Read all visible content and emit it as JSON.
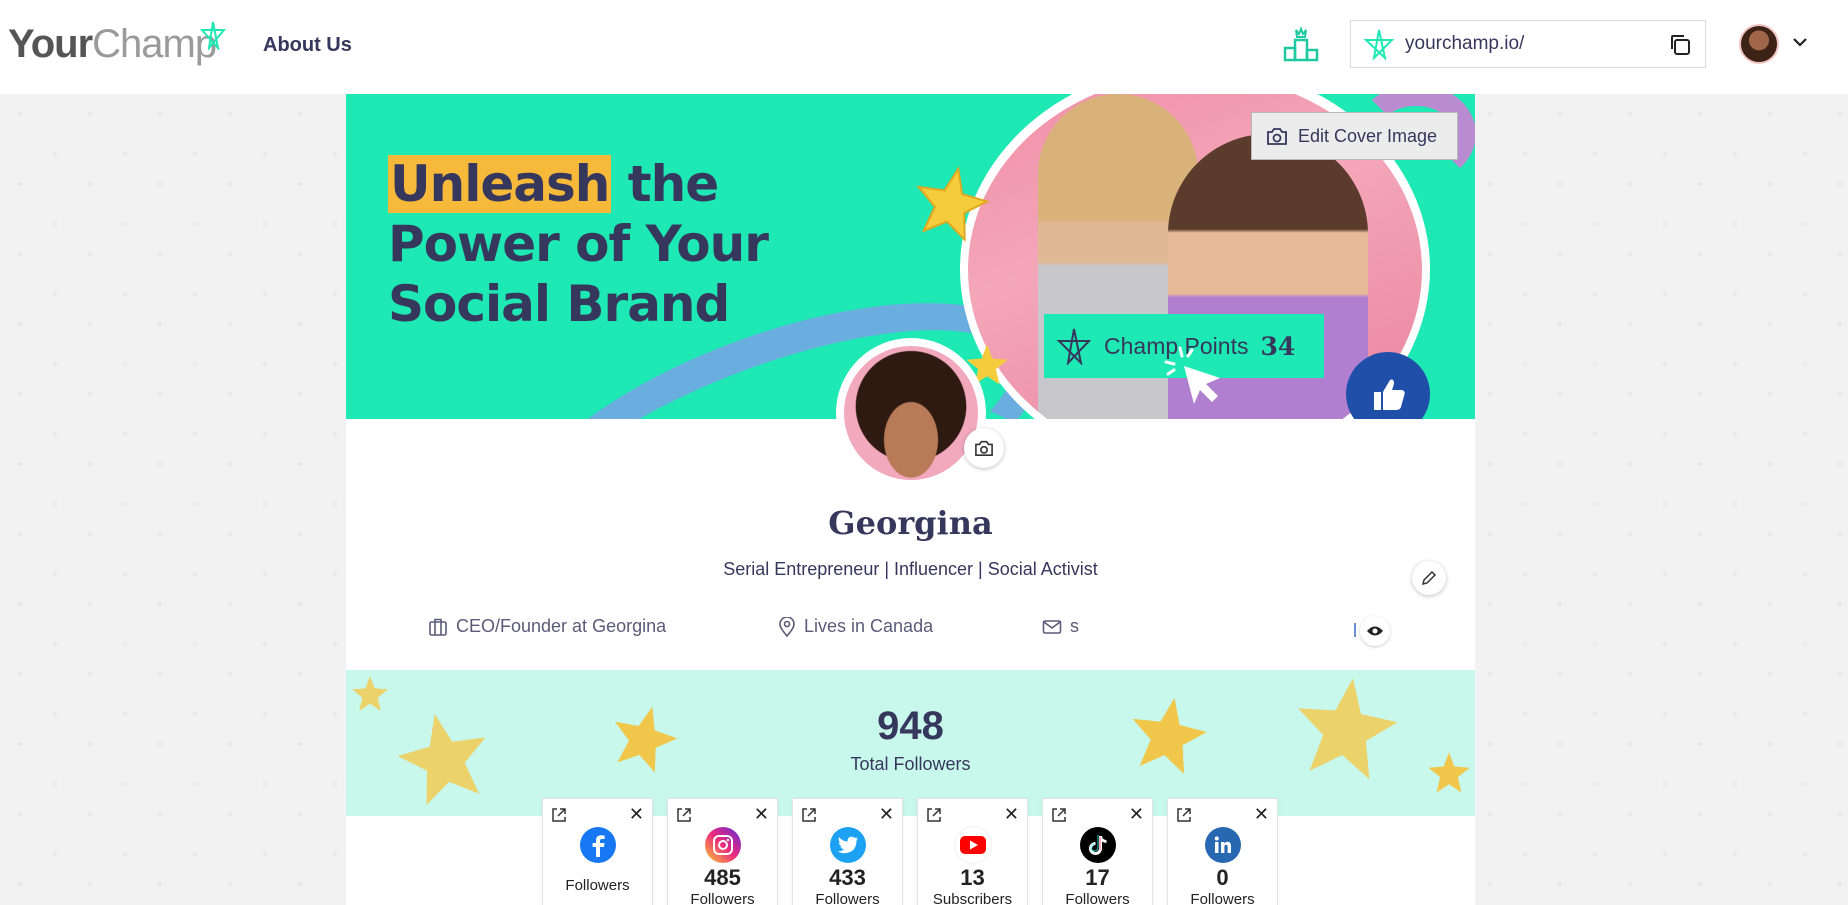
{
  "header": {
    "logo_your": "Your",
    "logo_champ": "Champ",
    "about_link": "About Us",
    "profile_url": "yourchamp.io/"
  },
  "cover": {
    "headline_highlight": "Unleash",
    "headline_rest_1": " the",
    "headline_line2": "Power of Your",
    "headline_line3": "Social Brand",
    "edit_cover_label": "Edit Cover Image",
    "champ_points_label": "Champ Points",
    "champ_points_value": "34"
  },
  "profile": {
    "name": "Georgina",
    "bio": "Serial Entrepreneur | Influencer | Social Activist",
    "job": "CEO/Founder at Georgina",
    "location": "Lives in Canada",
    "email": "s"
  },
  "followers": {
    "total": "948",
    "total_label": "Total Followers",
    "accounts": [
      {
        "platform": "facebook-icon",
        "count": "",
        "label": "Followers",
        "color": "#1877f2"
      },
      {
        "platform": "instagram-icon",
        "count": "485",
        "label": "Followers",
        "color": "#d6249f"
      },
      {
        "platform": "twitter-icon",
        "count": "433",
        "label": "Followers",
        "color": "#1da1f2"
      },
      {
        "platform": "youtube-icon",
        "count": "13",
        "label": "Subscribers",
        "color": "#ff0000"
      },
      {
        "platform": "tiktok-icon",
        "count": "17",
        "label": "Followers",
        "color": "#000000"
      },
      {
        "platform": "linkedin-icon",
        "count": "0",
        "label": "Followers",
        "color": "#2867b2"
      }
    ]
  },
  "colors": {
    "brand_teal": "#1ee8b3",
    "navy": "#36375c",
    "highlight": "#f7b93a",
    "band": "#c8f8ec"
  }
}
